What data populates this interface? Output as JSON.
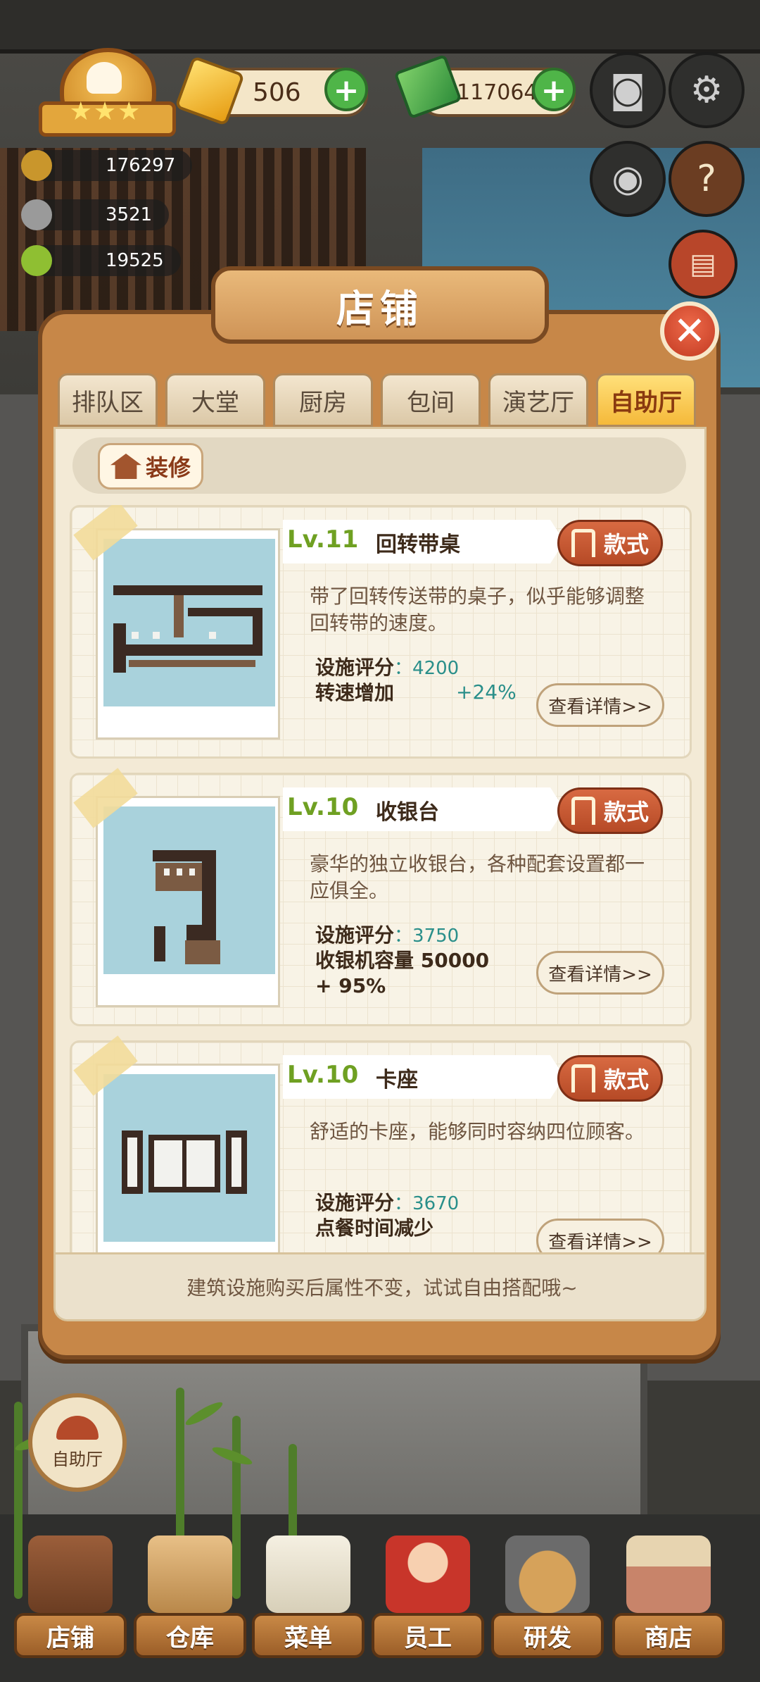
{
  "hud": {
    "gems": "506",
    "cash": "1170642",
    "stats": [
      "176297",
      "3521",
      "19525"
    ]
  },
  "panel": {
    "title": "店铺",
    "tabs": [
      {
        "label": "排队区",
        "active": false
      },
      {
        "label": "大堂",
        "active": false
      },
      {
        "label": "厨房",
        "active": false
      },
      {
        "label": "包间",
        "active": false
      },
      {
        "label": "演艺厅",
        "active": false
      },
      {
        "label": "自助厅",
        "active": true
      }
    ],
    "decorate_label": "装修",
    "items": [
      {
        "level": "Lv.11",
        "name": "回转带桌",
        "style_label": "款式",
        "description": "带了回转传送带的桌子，似乎能够调整回转带的速度。",
        "score_label": "设施评分",
        "score_value": "4200",
        "attr_label": "转速增加",
        "attr_value": "+24%",
        "detail_label": "查看详情>>"
      },
      {
        "level": "Lv.10",
        "name": "收银台",
        "style_label": "款式",
        "description": "豪华的独立收银台，各种配套设置都一应俱全。",
        "score_label": "设施评分",
        "score_value": "3750",
        "attr_label": "收银机容量 50000 + 95%",
        "attr_value": "",
        "detail_label": "查看详情>>"
      },
      {
        "level": "Lv.10",
        "name": "卡座",
        "style_label": "款式",
        "description": "舒适的卡座，能够同时容纳四位顾客。",
        "score_label": "设施评分",
        "score_value": "3670",
        "attr_label": "点餐时间减少",
        "attr_value": "",
        "detail_label": "查看详情>>"
      }
    ],
    "footer_note": "建筑设施购买后属性不变，试试自由搭配哦~"
  },
  "side_button": {
    "label": "自助厅"
  },
  "bottom_nav": [
    {
      "label": "店铺"
    },
    {
      "label": "仓库"
    },
    {
      "label": "菜单"
    },
    {
      "label": "员工"
    },
    {
      "label": "研发"
    },
    {
      "label": "商店"
    }
  ],
  "colors": {
    "panel": "#c78748",
    "tab_active": "#f5b93a",
    "accent_red": "#c23a22",
    "level_green": "#6fa022",
    "value_teal": "#2a8f8a"
  },
  "icons": [
    "chef-badge-icon",
    "gem-icon",
    "cash-icon",
    "camera-icon",
    "settings-icon",
    "eye-icon",
    "guide-book-icon",
    "red-book-icon",
    "close-icon",
    "house-icon",
    "chair-icon",
    "cloche-icon"
  ]
}
